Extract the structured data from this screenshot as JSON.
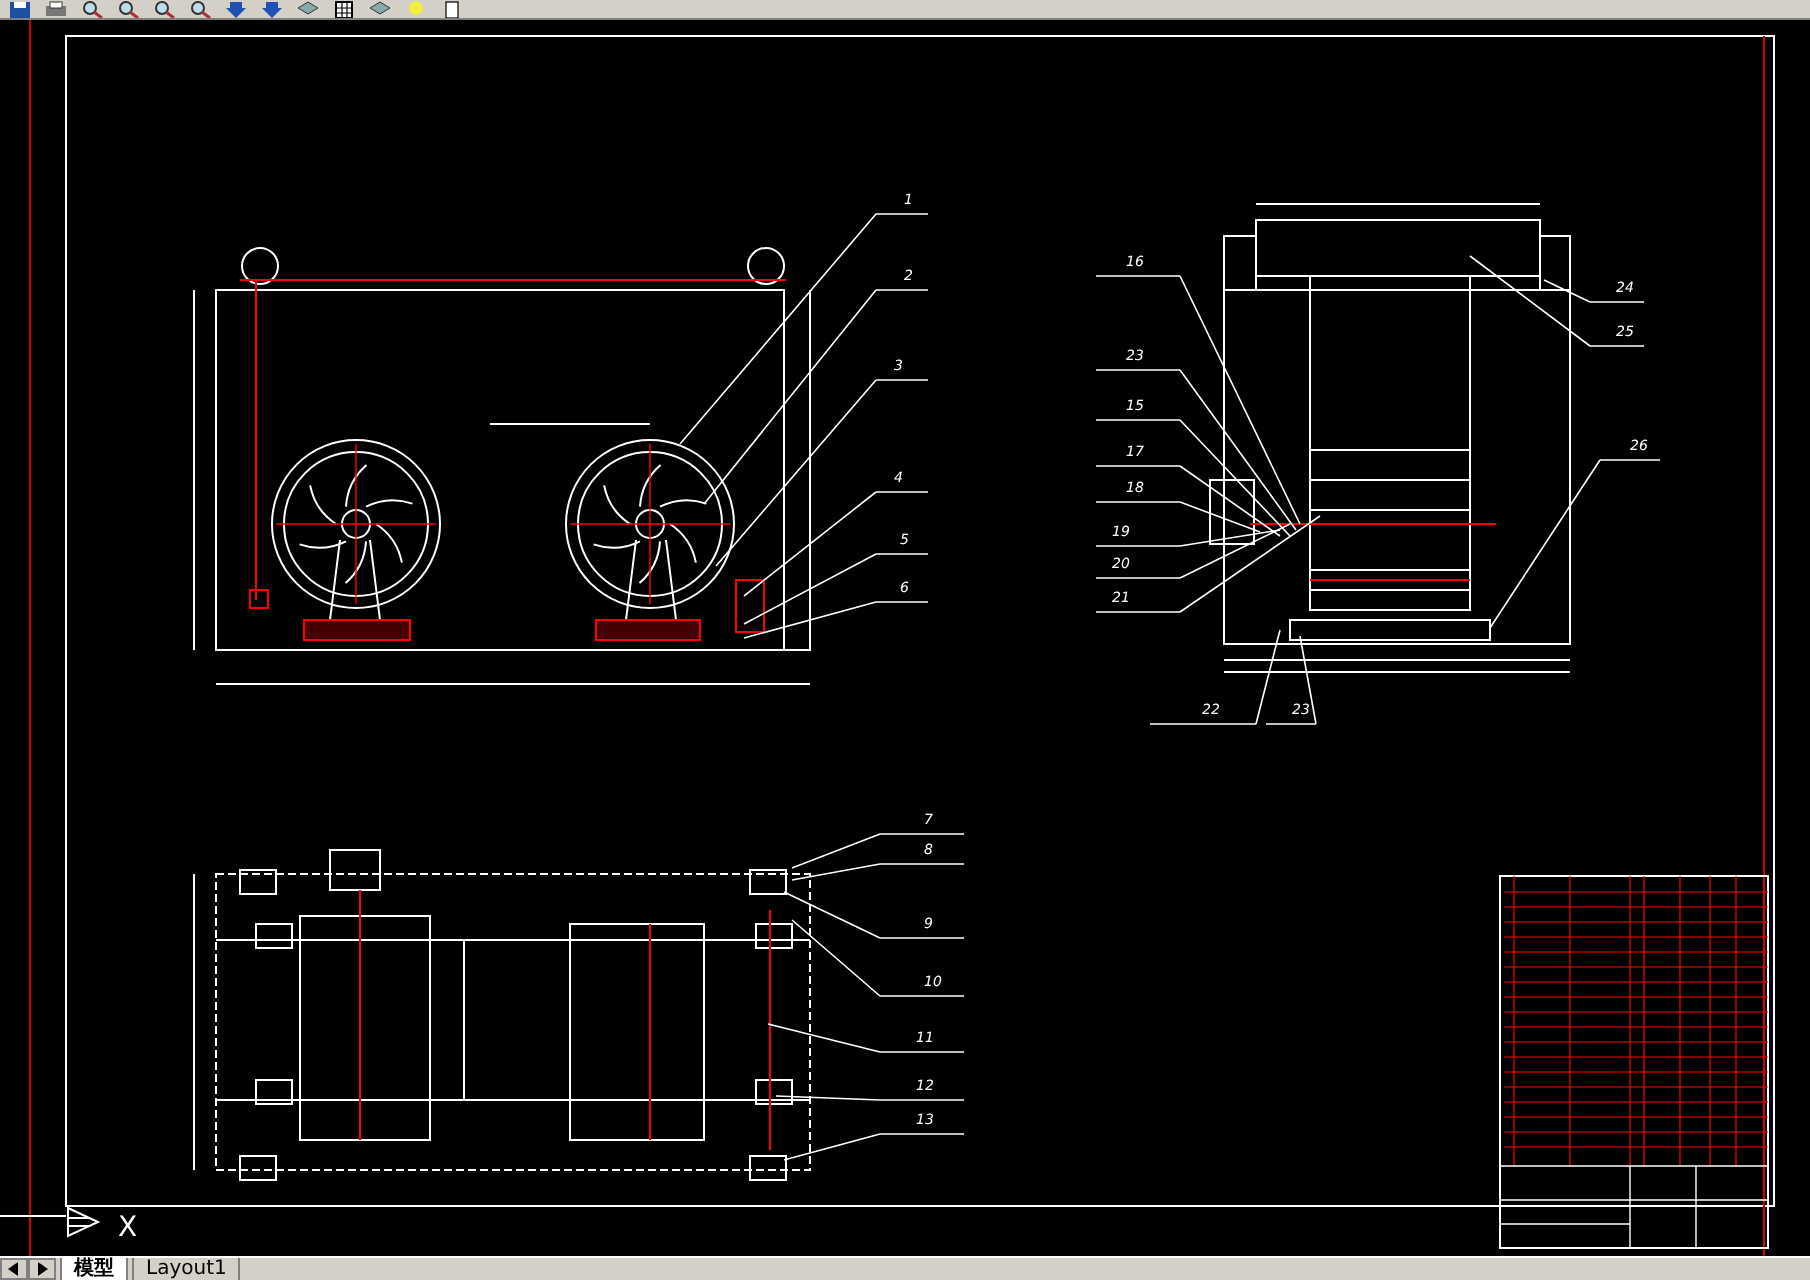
{
  "front_view": {
    "callouts": [
      "1",
      "2",
      "3",
      "4",
      "5",
      "6"
    ]
  },
  "side_view": {
    "callouts": [
      "16",
      "23",
      "15",
      "17",
      "18",
      "19",
      "20",
      "21",
      "22",
      "23",
      "24",
      "25",
      "26"
    ]
  },
  "top_view": {
    "callouts": [
      "7",
      "8",
      "9",
      "10",
      "11",
      "12",
      "13"
    ]
  },
  "ucs": {
    "axis_label": "X"
  },
  "tabs": [
    {
      "label": "模型",
      "selected": true
    },
    {
      "label": "Layout1",
      "selected": false
    }
  ]
}
